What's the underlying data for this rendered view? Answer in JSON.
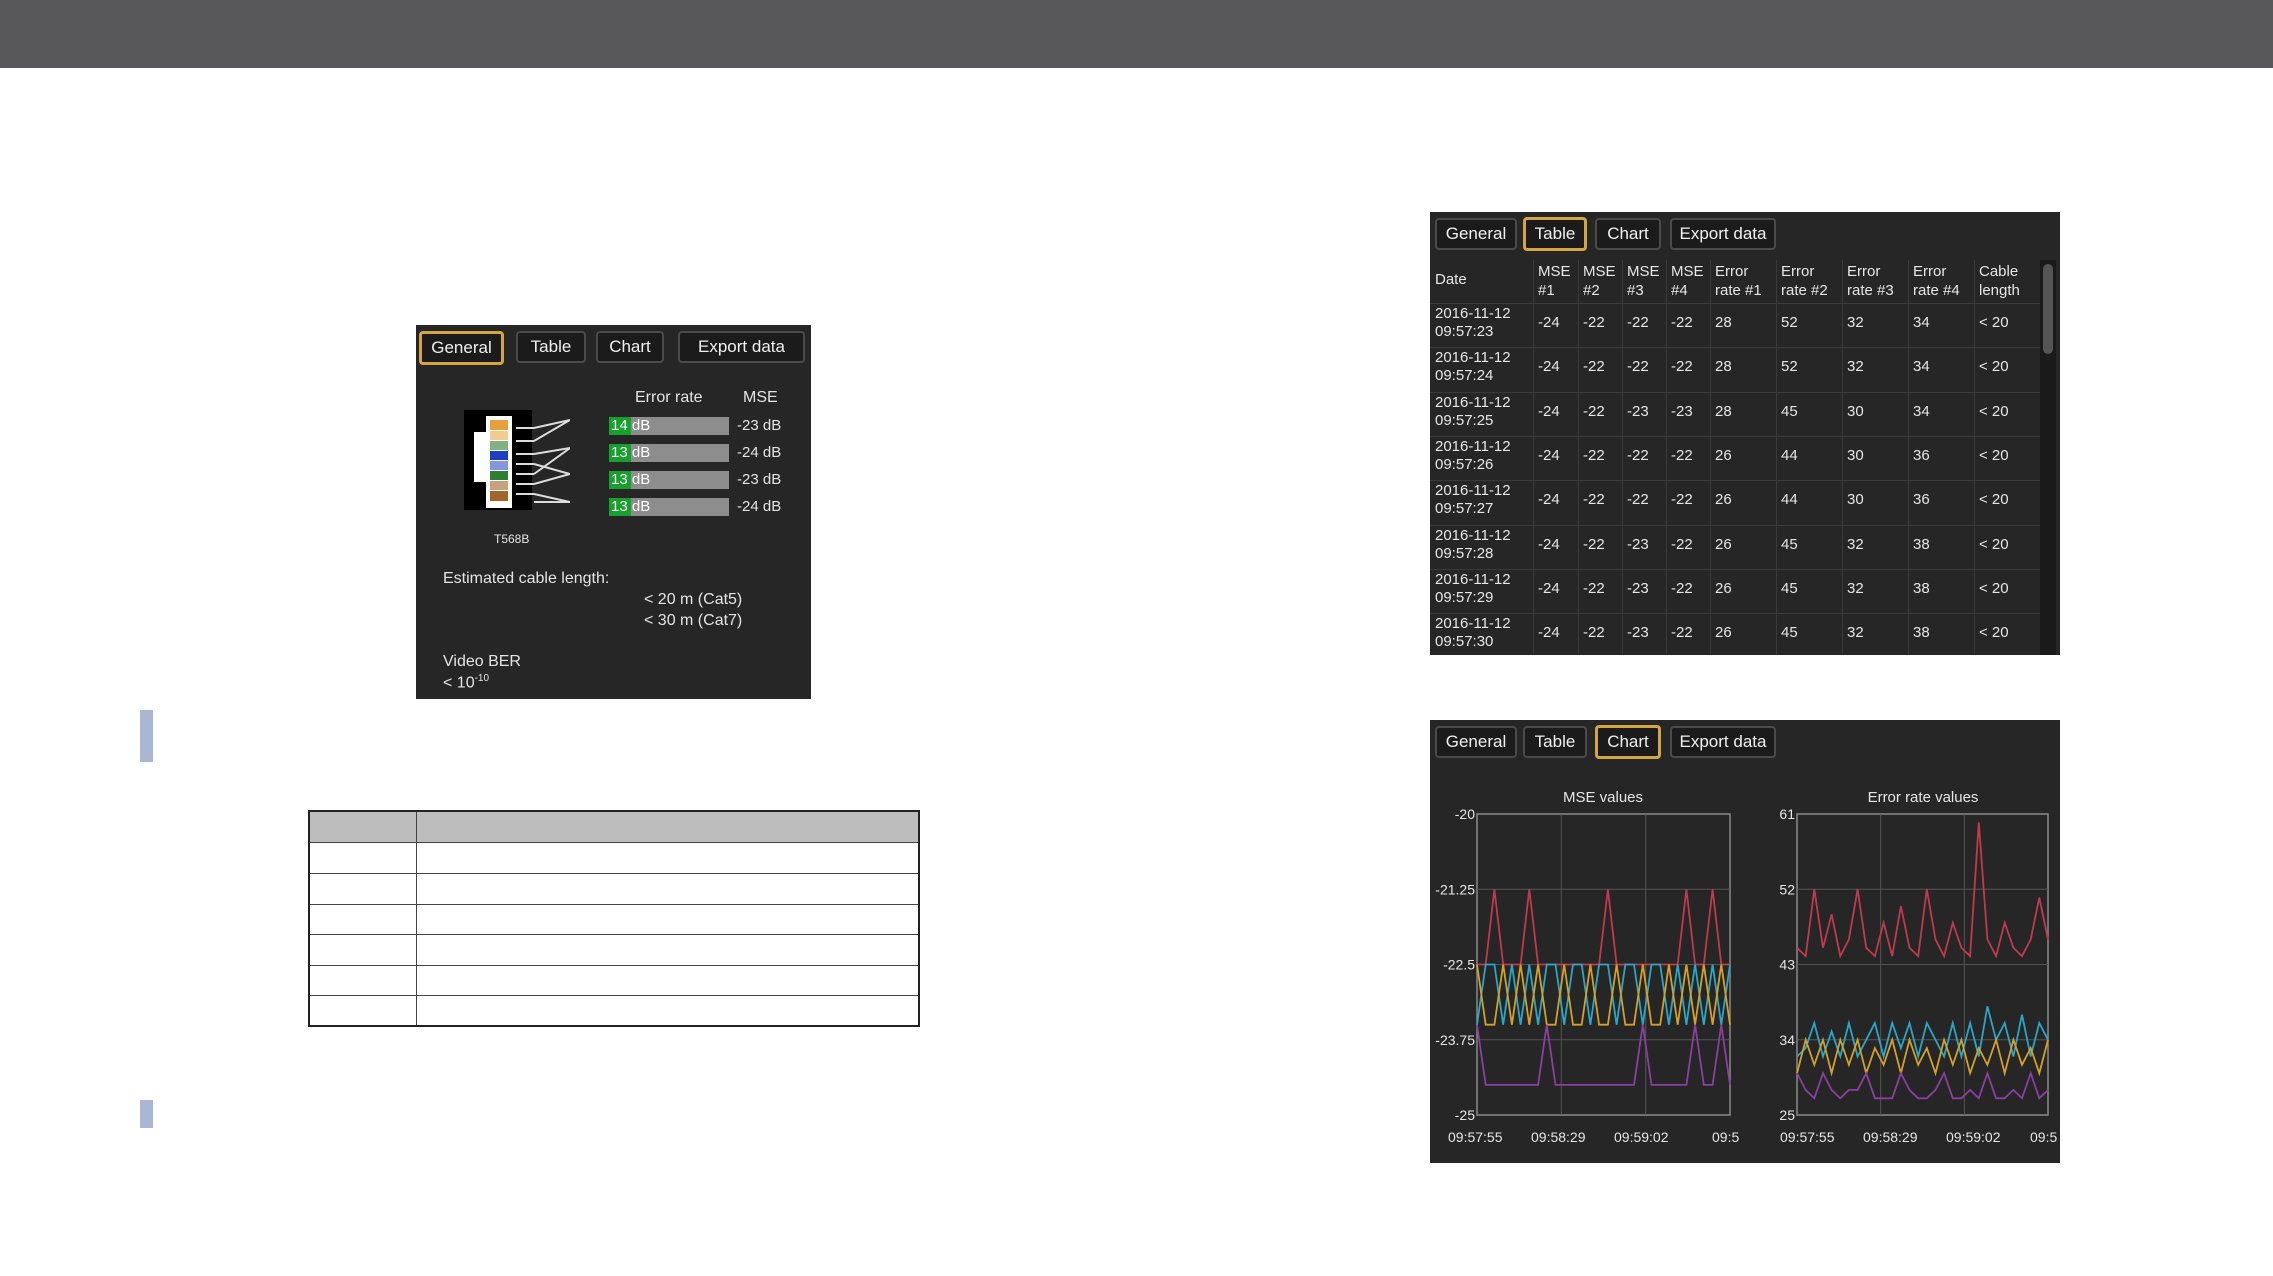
{
  "general_panel": {
    "tabs": [
      "General",
      "Table",
      "Chart",
      "Export data"
    ],
    "active_tab": "General",
    "col_error_rate": "Error rate",
    "col_mse": "MSE",
    "pairs": [
      {
        "error_rate": "14 dB",
        "mse": "-23 dB"
      },
      {
        "error_rate": "13 dB",
        "mse": "-24 dB"
      },
      {
        "error_rate": "13 dB",
        "mse": "-23 dB"
      },
      {
        "error_rate": "13 dB",
        "mse": "-24 dB"
      }
    ],
    "connector_label": "T568B",
    "cable_length_label": "Estimated cable length:",
    "cable_cat5": "< 20 m (Cat5)",
    "cable_cat7": "< 30 m (Cat7)",
    "video_ber_label": "Video BER",
    "video_ber_value": "< 10",
    "video_ber_exp": "-10"
  },
  "table_panel": {
    "tabs": [
      "General",
      "Table",
      "Chart",
      "Export data"
    ],
    "active_tab": "Table",
    "headers": [
      "Date",
      "MSE #1",
      "MSE #2",
      "MSE #3",
      "MSE #4",
      "Error rate #1",
      "Error rate #2",
      "Error rate #3",
      "Error rate #4",
      "Cable length"
    ],
    "header_lines": [
      [
        "Date",
        ""
      ],
      [
        "MSE",
        "#1"
      ],
      [
        "MSE",
        "#2"
      ],
      [
        "MSE",
        "#3"
      ],
      [
        "MSE",
        "#4"
      ],
      [
        "Error",
        "rate #1"
      ],
      [
        "Error",
        "rate #2"
      ],
      [
        "Error",
        "rate #3"
      ],
      [
        "Error",
        "rate #4"
      ],
      [
        "Cable",
        "length"
      ]
    ],
    "rows": [
      [
        "2016-11-12",
        "09:57:23",
        "-24",
        "-22",
        "-22",
        "-22",
        "28",
        "52",
        "32",
        "34",
        "< 20"
      ],
      [
        "2016-11-12",
        "09:57:24",
        "-24",
        "-22",
        "-22",
        "-22",
        "28",
        "52",
        "32",
        "34",
        "< 20"
      ],
      [
        "2016-11-12",
        "09:57:25",
        "-24",
        "-22",
        "-23",
        "-23",
        "28",
        "45",
        "30",
        "34",
        "< 20"
      ],
      [
        "2016-11-12",
        "09:57:26",
        "-24",
        "-22",
        "-22",
        "-22",
        "26",
        "44",
        "30",
        "36",
        "< 20"
      ],
      [
        "2016-11-12",
        "09:57:27",
        "-24",
        "-22",
        "-22",
        "-22",
        "26",
        "44",
        "30",
        "36",
        "< 20"
      ],
      [
        "2016-11-12",
        "09:57:28",
        "-24",
        "-22",
        "-23",
        "-22",
        "26",
        "45",
        "32",
        "38",
        "< 20"
      ],
      [
        "2016-11-12",
        "09:57:29",
        "-24",
        "-22",
        "-23",
        "-22",
        "26",
        "45",
        "32",
        "38",
        "< 20"
      ],
      [
        "2016-11-12",
        "09:57:30",
        "-24",
        "-22",
        "-23",
        "-22",
        "26",
        "45",
        "32",
        "38",
        "< 20"
      ]
    ]
  },
  "chart_panel": {
    "tabs": [
      "General",
      "Table",
      "Chart",
      "Export data"
    ],
    "active_tab": "Chart"
  },
  "chart_data": [
    {
      "type": "line",
      "title": "MSE values",
      "yticks": [
        "-20",
        "-21.25",
        "-22.5",
        "-23.75",
        "-25"
      ],
      "ylim": [
        -25,
        -20
      ],
      "xticks": [
        "09:57:55",
        "09:58:29",
        "09:59:02",
        "09:5"
      ],
      "grid": true,
      "colors": [
        "#c03a4e",
        "#2aa6c8",
        "#d4a02a",
        "#8b3fa0"
      ],
      "series": [
        {
          "values": [
            -22.5,
            -22.5,
            -21.25,
            -22.5,
            -22.5,
            -22.5,
            -21.25,
            -22.5,
            -22.5,
            -22.5,
            -22.5,
            -22.5,
            -22.5,
            -22.5,
            -22.5,
            -21.25,
            -22.5,
            -22.5,
            -22.5,
            -22.5,
            -22.5,
            -22.5,
            -22.5,
            -22.5,
            -21.25,
            -22.5,
            -22.5,
            -21.25,
            -22.5,
            -22.5
          ]
        },
        {
          "values": [
            -23.5,
            -22.5,
            -22.5,
            -23.5,
            -22.5,
            -23.5,
            -22.5,
            -23.5,
            -22.5,
            -22.5,
            -23.5,
            -22.5,
            -22.5,
            -23.5,
            -22.5,
            -22.5,
            -23.5,
            -22.5,
            -22.5,
            -23.5,
            -22.5,
            -22.5,
            -23.5,
            -22.5,
            -23.5,
            -22.5,
            -23.5,
            -22.5,
            -23.5,
            -22.5
          ]
        },
        {
          "values": [
            -22.5,
            -23.5,
            -23.5,
            -22.5,
            -23.5,
            -22.5,
            -23.5,
            -22.5,
            -23.5,
            -23.5,
            -22.5,
            -23.5,
            -23.5,
            -22.5,
            -23.5,
            -23.5,
            -22.5,
            -23.5,
            -23.5,
            -22.5,
            -23.5,
            -23.5,
            -22.5,
            -23.5,
            -22.5,
            -23.5,
            -22.5,
            -23.5,
            -22.5,
            -23.5
          ]
        },
        {
          "values": [
            -23.5,
            -24.5,
            -24.5,
            -24.5,
            -24.5,
            -24.5,
            -24.5,
            -24.5,
            -23.5,
            -24.5,
            -24.5,
            -24.5,
            -24.5,
            -24.5,
            -24.5,
            -24.5,
            -24.5,
            -24.5,
            -24.5,
            -23.5,
            -24.5,
            -24.5,
            -24.5,
            -24.5,
            -24.5,
            -23.5,
            -24.5,
            -24.5,
            -23.5,
            -24.5
          ]
        }
      ]
    },
    {
      "type": "line",
      "title": "Error rate values",
      "yticks": [
        "61",
        "52",
        "43",
        "34",
        "25"
      ],
      "ylim": [
        25,
        61
      ],
      "xticks": [
        "09:57:55",
        "09:58:29",
        "09:59:02",
        "09:5"
      ],
      "grid": true,
      "colors": [
        "#c03a4e",
        "#2aa6c8",
        "#d4a02a",
        "#8b3fa0"
      ],
      "series": [
        {
          "values": [
            45,
            44,
            52,
            45,
            49,
            44,
            46,
            52,
            45,
            44,
            48,
            44,
            50,
            45,
            44,
            52,
            46,
            44,
            48,
            45,
            44,
            60,
            46,
            44,
            48,
            45,
            44,
            46,
            51,
            46
          ]
        },
        {
          "values": [
            32,
            33,
            36,
            32,
            35,
            32,
            36,
            32,
            34,
            36,
            32,
            36,
            33,
            36,
            32,
            36,
            34,
            32,
            36,
            32,
            36,
            32,
            38,
            34,
            36,
            32,
            37,
            32,
            36,
            34
          ]
        },
        {
          "values": [
            30,
            34,
            31,
            34,
            30,
            34,
            31,
            34,
            30,
            33,
            31,
            34,
            30,
            34,
            31,
            33,
            30,
            34,
            31,
            34,
            30,
            33,
            31,
            34,
            30,
            34,
            31,
            33,
            30,
            34
          ]
        },
        {
          "values": [
            30,
            28,
            27,
            30,
            28,
            27,
            28,
            28,
            30,
            27,
            27,
            27,
            30,
            28,
            27,
            27,
            28,
            30,
            27,
            27,
            28,
            27,
            30,
            27,
            27,
            28,
            27,
            30,
            27,
            28
          ]
        }
      ]
    }
  ]
}
